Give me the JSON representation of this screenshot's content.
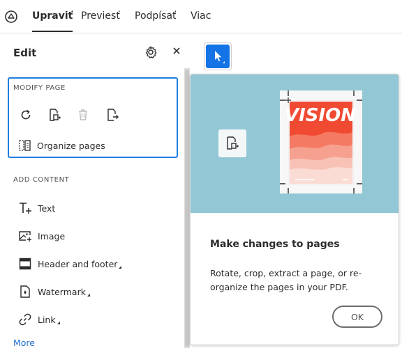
{
  "tabs": [
    "Upraviť",
    "Previesť",
    "Podpísať",
    "Viac"
  ],
  "panel": {
    "title": "Edit",
    "modify_page": {
      "label": "MODIFY PAGE",
      "organize_label": "Organize pages"
    },
    "add_content": {
      "label": "ADD CONTENT",
      "tools": [
        "Text",
        "Image",
        "Header and footer",
        "Watermark",
        "Link"
      ]
    },
    "more_label": "More"
  },
  "coachmark": {
    "illustration_text": "VISION",
    "title": "Make changes to pages",
    "body": "Rotate, crop, extract a page, or re-organize the pages in your PDF.",
    "ok_label": "OK"
  },
  "colors": {
    "accent": "#1473e6",
    "focus_ring": "#1f7ee0",
    "hero_bg": "#93c7d6",
    "link": "#1f6fd1"
  }
}
